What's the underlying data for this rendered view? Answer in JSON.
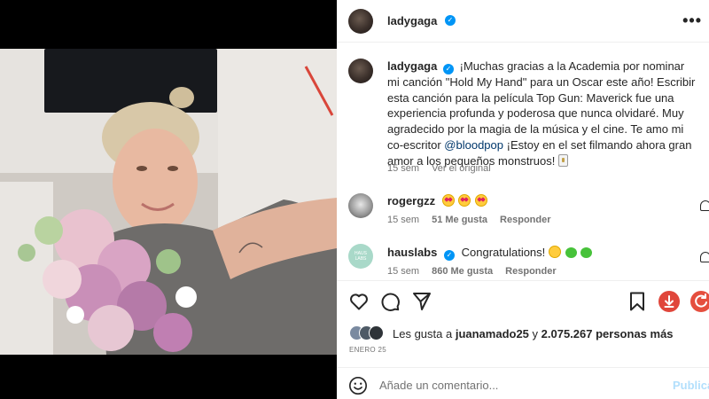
{
  "post": {
    "username": "ladygaga",
    "more_label": "•••",
    "image_alt": "Selfie con un ramo de flores rosas y plumas"
  },
  "caption": {
    "username": "ladygaga",
    "text_before_mention": "¡Muchas gracias a la Academia por nominar mi canción \"Hold My Hand\" para un Oscar este año! Escribir esta canción para la película Top Gun: Maverick fue una experiencia profunda y poderosa que nunca olvidaré. Muy agradecido por la magia de la música y el cine. Te amo mi co-escritor ",
    "mention": "@bloodpop",
    "text_after_mention": " ¡Estoy en el set filmando ahora gran amor a los pequeños monstruos! ",
    "time": "15 sem",
    "see_translation": "Ver el original"
  },
  "comments": [
    {
      "username": "rogergzz",
      "emojis": [
        "star-struck",
        "star-struck",
        "star-struck"
      ],
      "text": "",
      "time": "15 sem",
      "likes": "51 Me gusta",
      "reply": "Responder"
    },
    {
      "username": "hauslabs",
      "avatar_text": "HAUS LABS",
      "text": "Congratulations!",
      "emojis": [
        "partying-face",
        "green-heart",
        "green-heart"
      ],
      "time": "15 sem",
      "likes": "860 Me gusta",
      "reply": "Responder"
    }
  ],
  "actions": {
    "like": "heart-icon",
    "comment": "comment-icon",
    "share": "share-icon",
    "save": "bookmark-icon",
    "download": "download-icon"
  },
  "likes": {
    "prefix": "Les gusta a ",
    "user": "juanamado25",
    "middle": " y ",
    "count": "2.075.267 personas más"
  },
  "date": "ENERO 25",
  "comment_box": {
    "placeholder": "Añade un comentario...",
    "post_label": "Publicar"
  },
  "colors": {
    "accent": "#0095f6",
    "mention": "#00376b",
    "muted": "#737373",
    "download": "#e0463b"
  }
}
